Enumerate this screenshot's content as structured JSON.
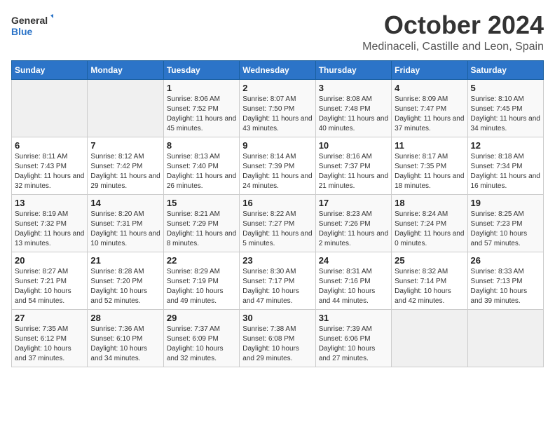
{
  "header": {
    "logo_line1": "General",
    "logo_line2": "Blue",
    "month": "October 2024",
    "location": "Medinaceli, Castille and Leon, Spain"
  },
  "weekdays": [
    "Sunday",
    "Monday",
    "Tuesday",
    "Wednesday",
    "Thursday",
    "Friday",
    "Saturday"
  ],
  "weeks": [
    [
      {
        "day": "",
        "info": ""
      },
      {
        "day": "",
        "info": ""
      },
      {
        "day": "1",
        "info": "Sunrise: 8:06 AM\nSunset: 7:52 PM\nDaylight: 11 hours and 45 minutes."
      },
      {
        "day": "2",
        "info": "Sunrise: 8:07 AM\nSunset: 7:50 PM\nDaylight: 11 hours and 43 minutes."
      },
      {
        "day": "3",
        "info": "Sunrise: 8:08 AM\nSunset: 7:48 PM\nDaylight: 11 hours and 40 minutes."
      },
      {
        "day": "4",
        "info": "Sunrise: 8:09 AM\nSunset: 7:47 PM\nDaylight: 11 hours and 37 minutes."
      },
      {
        "day": "5",
        "info": "Sunrise: 8:10 AM\nSunset: 7:45 PM\nDaylight: 11 hours and 34 minutes."
      }
    ],
    [
      {
        "day": "6",
        "info": "Sunrise: 8:11 AM\nSunset: 7:43 PM\nDaylight: 11 hours and 32 minutes."
      },
      {
        "day": "7",
        "info": "Sunrise: 8:12 AM\nSunset: 7:42 PM\nDaylight: 11 hours and 29 minutes."
      },
      {
        "day": "8",
        "info": "Sunrise: 8:13 AM\nSunset: 7:40 PM\nDaylight: 11 hours and 26 minutes."
      },
      {
        "day": "9",
        "info": "Sunrise: 8:14 AM\nSunset: 7:39 PM\nDaylight: 11 hours and 24 minutes."
      },
      {
        "day": "10",
        "info": "Sunrise: 8:16 AM\nSunset: 7:37 PM\nDaylight: 11 hours and 21 minutes."
      },
      {
        "day": "11",
        "info": "Sunrise: 8:17 AM\nSunset: 7:35 PM\nDaylight: 11 hours and 18 minutes."
      },
      {
        "day": "12",
        "info": "Sunrise: 8:18 AM\nSunset: 7:34 PM\nDaylight: 11 hours and 16 minutes."
      }
    ],
    [
      {
        "day": "13",
        "info": "Sunrise: 8:19 AM\nSunset: 7:32 PM\nDaylight: 11 hours and 13 minutes."
      },
      {
        "day": "14",
        "info": "Sunrise: 8:20 AM\nSunset: 7:31 PM\nDaylight: 11 hours and 10 minutes."
      },
      {
        "day": "15",
        "info": "Sunrise: 8:21 AM\nSunset: 7:29 PM\nDaylight: 11 hours and 8 minutes."
      },
      {
        "day": "16",
        "info": "Sunrise: 8:22 AM\nSunset: 7:27 PM\nDaylight: 11 hours and 5 minutes."
      },
      {
        "day": "17",
        "info": "Sunrise: 8:23 AM\nSunset: 7:26 PM\nDaylight: 11 hours and 2 minutes."
      },
      {
        "day": "18",
        "info": "Sunrise: 8:24 AM\nSunset: 7:24 PM\nDaylight: 11 hours and 0 minutes."
      },
      {
        "day": "19",
        "info": "Sunrise: 8:25 AM\nSunset: 7:23 PM\nDaylight: 10 hours and 57 minutes."
      }
    ],
    [
      {
        "day": "20",
        "info": "Sunrise: 8:27 AM\nSunset: 7:21 PM\nDaylight: 10 hours and 54 minutes."
      },
      {
        "day": "21",
        "info": "Sunrise: 8:28 AM\nSunset: 7:20 PM\nDaylight: 10 hours and 52 minutes."
      },
      {
        "day": "22",
        "info": "Sunrise: 8:29 AM\nSunset: 7:19 PM\nDaylight: 10 hours and 49 minutes."
      },
      {
        "day": "23",
        "info": "Sunrise: 8:30 AM\nSunset: 7:17 PM\nDaylight: 10 hours and 47 minutes."
      },
      {
        "day": "24",
        "info": "Sunrise: 8:31 AM\nSunset: 7:16 PM\nDaylight: 10 hours and 44 minutes."
      },
      {
        "day": "25",
        "info": "Sunrise: 8:32 AM\nSunset: 7:14 PM\nDaylight: 10 hours and 42 minutes."
      },
      {
        "day": "26",
        "info": "Sunrise: 8:33 AM\nSunset: 7:13 PM\nDaylight: 10 hours and 39 minutes."
      }
    ],
    [
      {
        "day": "27",
        "info": "Sunrise: 7:35 AM\nSunset: 6:12 PM\nDaylight: 10 hours and 37 minutes."
      },
      {
        "day": "28",
        "info": "Sunrise: 7:36 AM\nSunset: 6:10 PM\nDaylight: 10 hours and 34 minutes."
      },
      {
        "day": "29",
        "info": "Sunrise: 7:37 AM\nSunset: 6:09 PM\nDaylight: 10 hours and 32 minutes."
      },
      {
        "day": "30",
        "info": "Sunrise: 7:38 AM\nSunset: 6:08 PM\nDaylight: 10 hours and 29 minutes."
      },
      {
        "day": "31",
        "info": "Sunrise: 7:39 AM\nSunset: 6:06 PM\nDaylight: 10 hours and 27 minutes."
      },
      {
        "day": "",
        "info": ""
      },
      {
        "day": "",
        "info": ""
      }
    ]
  ]
}
